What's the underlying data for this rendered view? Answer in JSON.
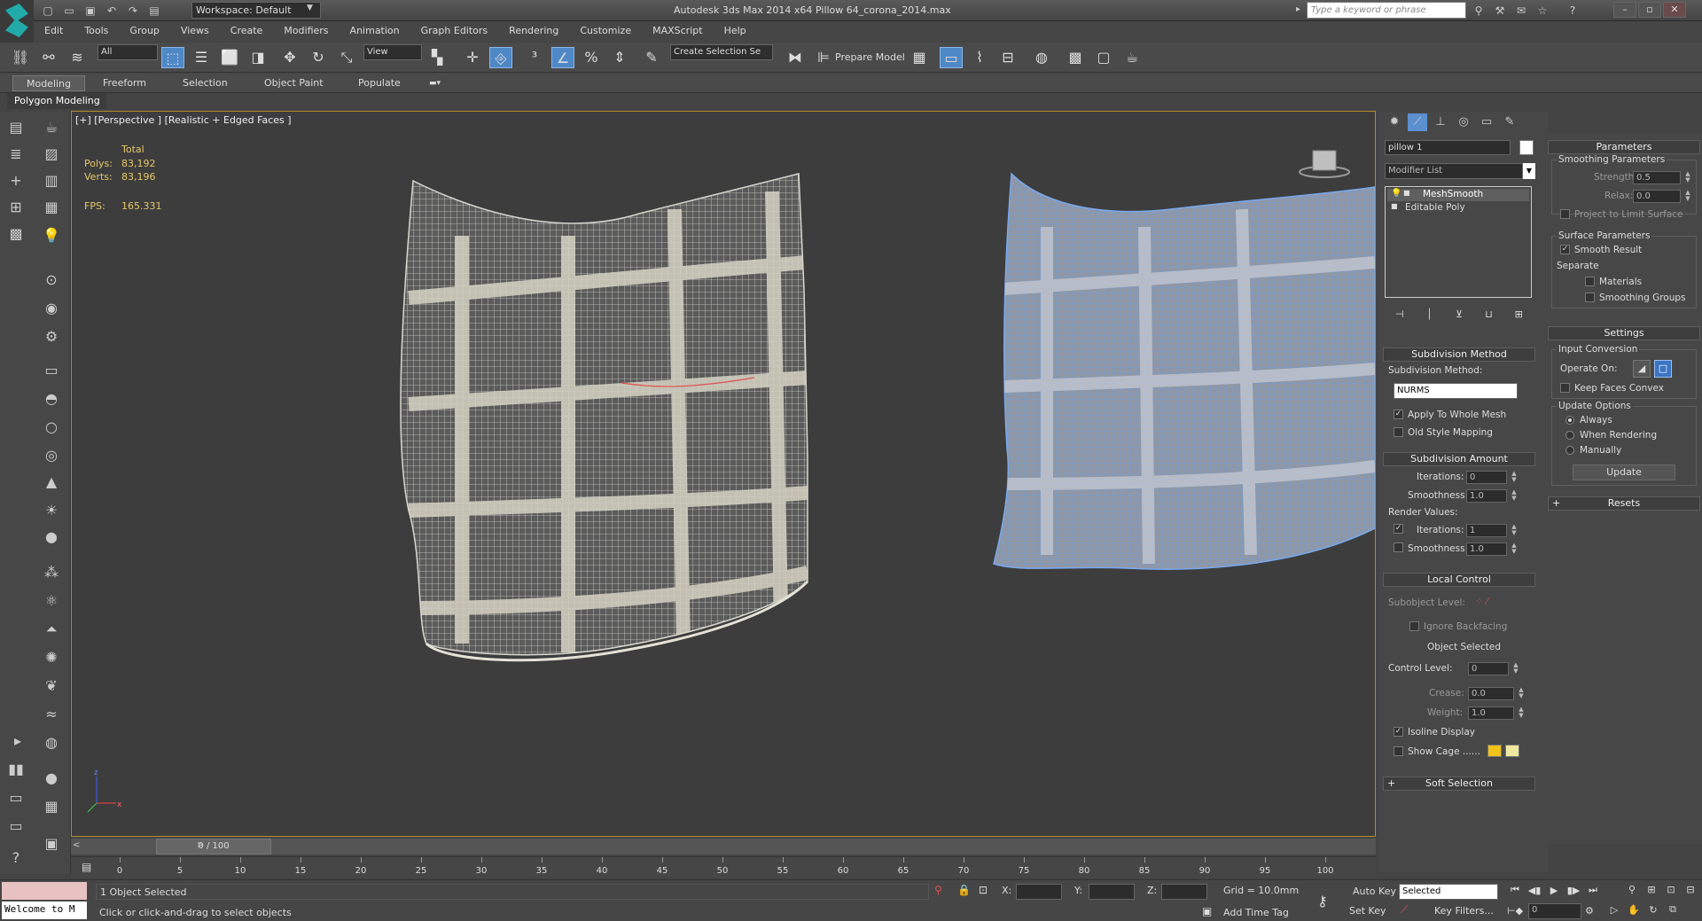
{
  "titlebar": {
    "workspace": "Workspace: Default",
    "app_title": "Autodesk 3ds Max  2014 x64",
    "file_title": "Pillow 64_corona_2014.max",
    "search_placeholder": "Type a keyword or phrase"
  },
  "menu": [
    "Edit",
    "Tools",
    "Group",
    "Views",
    "Create",
    "Modifiers",
    "Animation",
    "Graph Editors",
    "Rendering",
    "Customize",
    "MAXScript",
    "Help"
  ],
  "toolbar": {
    "selection_filter": "All",
    "ref_coord": "View",
    "named_selection": "Create Selection Se",
    "prepare_model": "Prepare Model"
  },
  "ribbon": {
    "tabs": [
      "Modeling",
      "Freeform",
      "Selection",
      "Object Paint",
      "Populate"
    ],
    "panel_label": "Polygon Modeling"
  },
  "viewport": {
    "label": "[+] [Perspective ] [Realistic + Edged Faces ]",
    "stats_header": "Total",
    "polys_label": "Polys:",
    "polys_value": "83,192",
    "verts_label": "Verts:",
    "verts_value": "83,196",
    "fps_label": "FPS:",
    "fps_value": "165.331"
  },
  "command_panel": {
    "object_name": "pillow 1",
    "modifier_list": "Modifier List",
    "stack": [
      "MeshSmooth",
      "Editable Poly"
    ],
    "subdivision_method": {
      "title": "Subdivision Method",
      "label": "Subdivision Method:",
      "value": "NURMS",
      "apply_whole": "Apply To Whole Mesh",
      "old_style": "Old Style Mapping"
    },
    "subdivision_amount": {
      "title": "Subdivision Amount",
      "iterations_label": "Iterations:",
      "iterations_value": "0",
      "smoothness_label": "Smoothness:",
      "smoothness_value": "1.0",
      "render_values": "Render Values:",
      "r_iterations_label": "Iterations:",
      "r_iterations_value": "1",
      "r_smoothness_label": "Smoothness:",
      "r_smoothness_value": "1.0"
    },
    "local_control": {
      "title": "Local Control",
      "subobject_level": "Subobject Level:",
      "ignore_backfacing": "Ignore Backfacing",
      "object_selected": "Object Selected",
      "control_level_label": "Control Level:",
      "control_level_value": "0",
      "crease_label": "Crease:",
      "crease_value": "0.0",
      "weight_label": "Weight:",
      "weight_value": "1.0",
      "isoline": "Isoline Display",
      "show_cage": "Show Cage ......"
    },
    "soft_selection": "Soft Selection"
  },
  "param_panel": {
    "parameters_title": "Parameters",
    "smoothing_group": "Smoothing Parameters",
    "strength_label": "Strength:",
    "strength_value": "0.5",
    "relax_label": "Relax:",
    "relax_value": "0.0",
    "project_limit": "Project to Limit Surface",
    "surface_group": "Surface Parameters",
    "smooth_result": "Smooth Result",
    "separate": "Separate",
    "materials": "Materials",
    "smoothing_groups": "Smoothing Groups",
    "settings_title": "Settings",
    "input_conversion": "Input Conversion",
    "operate_on": "Operate On:",
    "keep_faces_convex": "Keep Faces Convex",
    "update_options": "Update Options",
    "always": "Always",
    "when_rendering": "When Rendering",
    "manually": "Manually",
    "update_button": "Update",
    "resets": "Resets"
  },
  "timeline": {
    "slider": "0 / 100",
    "ticks": [
      "0",
      "5",
      "10",
      "15",
      "20",
      "25",
      "30",
      "35",
      "40",
      "45",
      "50",
      "55",
      "60",
      "65",
      "70",
      "75",
      "80",
      "85",
      "90",
      "95",
      "100"
    ]
  },
  "status": {
    "maxscript_line": "Welcome to M",
    "selected": "1 Object Selected",
    "prompt": "Click or click-and-drag to select objects",
    "x_label": "X:",
    "y_label": "Y:",
    "z_label": "Z:",
    "grid": "Grid = 10.0mm",
    "add_time_tag": "Add Time Tag",
    "auto_key": "Auto Key",
    "set_key": "Set Key",
    "key_mode": "Selected",
    "key_filters": "Key Filters...",
    "frame": "0"
  },
  "colors": {
    "cage_color_1": "#f2c21a",
    "cage_color_2": "#efe8a0",
    "viewport_border": "#b28b30"
  }
}
